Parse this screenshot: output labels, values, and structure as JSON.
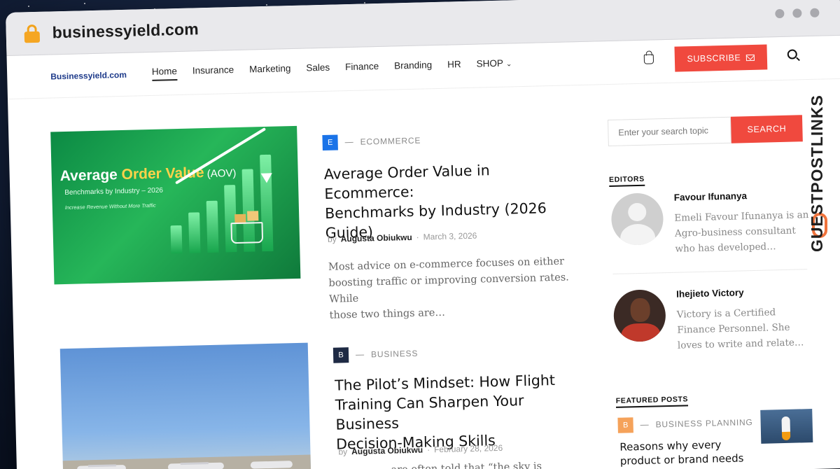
{
  "browser": {
    "url": "businessyield.com"
  },
  "site": {
    "logo_text": "Businessyield.com",
    "nav": [
      {
        "label": "Home"
      },
      {
        "label": "Insurance"
      },
      {
        "label": "Marketing"
      },
      {
        "label": "Sales"
      },
      {
        "label": "Finance"
      },
      {
        "label": "Branding"
      },
      {
        "label": "HR"
      },
      {
        "label": "SHOP"
      }
    ],
    "subscribe_label": "SUBSCRIBE"
  },
  "posts": [
    {
      "badge": "E",
      "badge_color": "#1a73e8",
      "category": "ECOMMERCE",
      "title_lines": [
        "Average Order Value in Ecommerce:",
        "Benchmarks by Industry (2026",
        "Guide)"
      ],
      "by": "by",
      "author": "Augusta Obiukwu",
      "date": "March 3, 2026",
      "excerpt_lines": [
        "Most advice on e-commerce focuses on either",
        "boosting traffic or improving conversion rates. While",
        "those two things are…"
      ],
      "image": {
        "line1a": "Average ",
        "line1b": "Order Value",
        "line1c": " (AOV)",
        "line2": "Benchmarks by Industry – 2026",
        "line3": "Increase Revenue Without More Traffic"
      }
    },
    {
      "badge": "B",
      "badge_color": "#1e2a44",
      "category": "BUSINESS",
      "title_lines": [
        "The Pilot’s Mindset: How Flight",
        "Training Can Sharpen Your Business",
        "Decision-Making Skills"
      ],
      "by": "by",
      "author": "Augusta Obiukwu",
      "date": "February 28, 2026",
      "excerpt_lines": [
        "…are often told that “the sky is"
      ]
    }
  ],
  "sidebar": {
    "search_placeholder": "Enter your search topic",
    "search_button": "SEARCH",
    "editors_title": "EDITORS",
    "editors": [
      {
        "name": "Favour Ifunanya",
        "bio": "Emeli Favour Ifunanya is an Agro-business consultant who has developed…"
      },
      {
        "name": "Ihejieto Victory",
        "bio": "Victory is a Certified Finance Personnel. She loves to write and relate…"
      }
    ],
    "featured_title": "FEATURED POSTS",
    "featured": [
      {
        "badge": "B",
        "badge_color": "#f5a25a",
        "category": "BUSINESS PLANNING",
        "title": "Reasons why every product or brand needs a"
      }
    ]
  },
  "watermark": {
    "text": "GUESTPOSTLINKS"
  }
}
